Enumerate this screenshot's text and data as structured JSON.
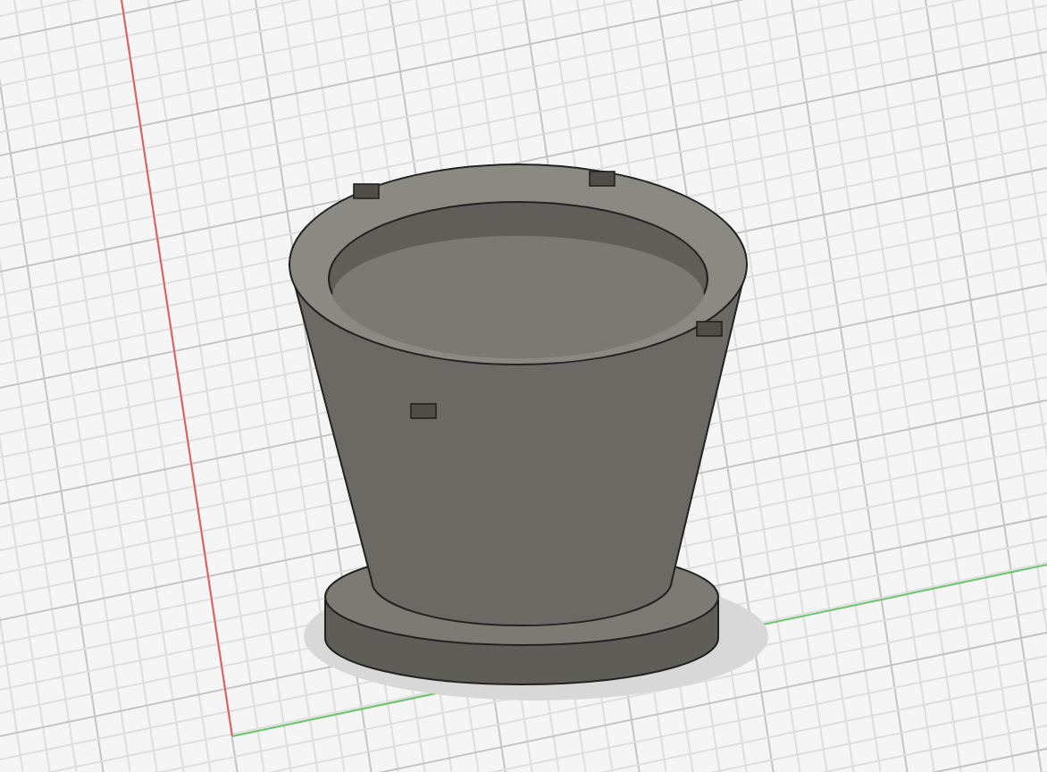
{
  "viewport": {
    "show_grid": true,
    "show_axes": true
  }
}
